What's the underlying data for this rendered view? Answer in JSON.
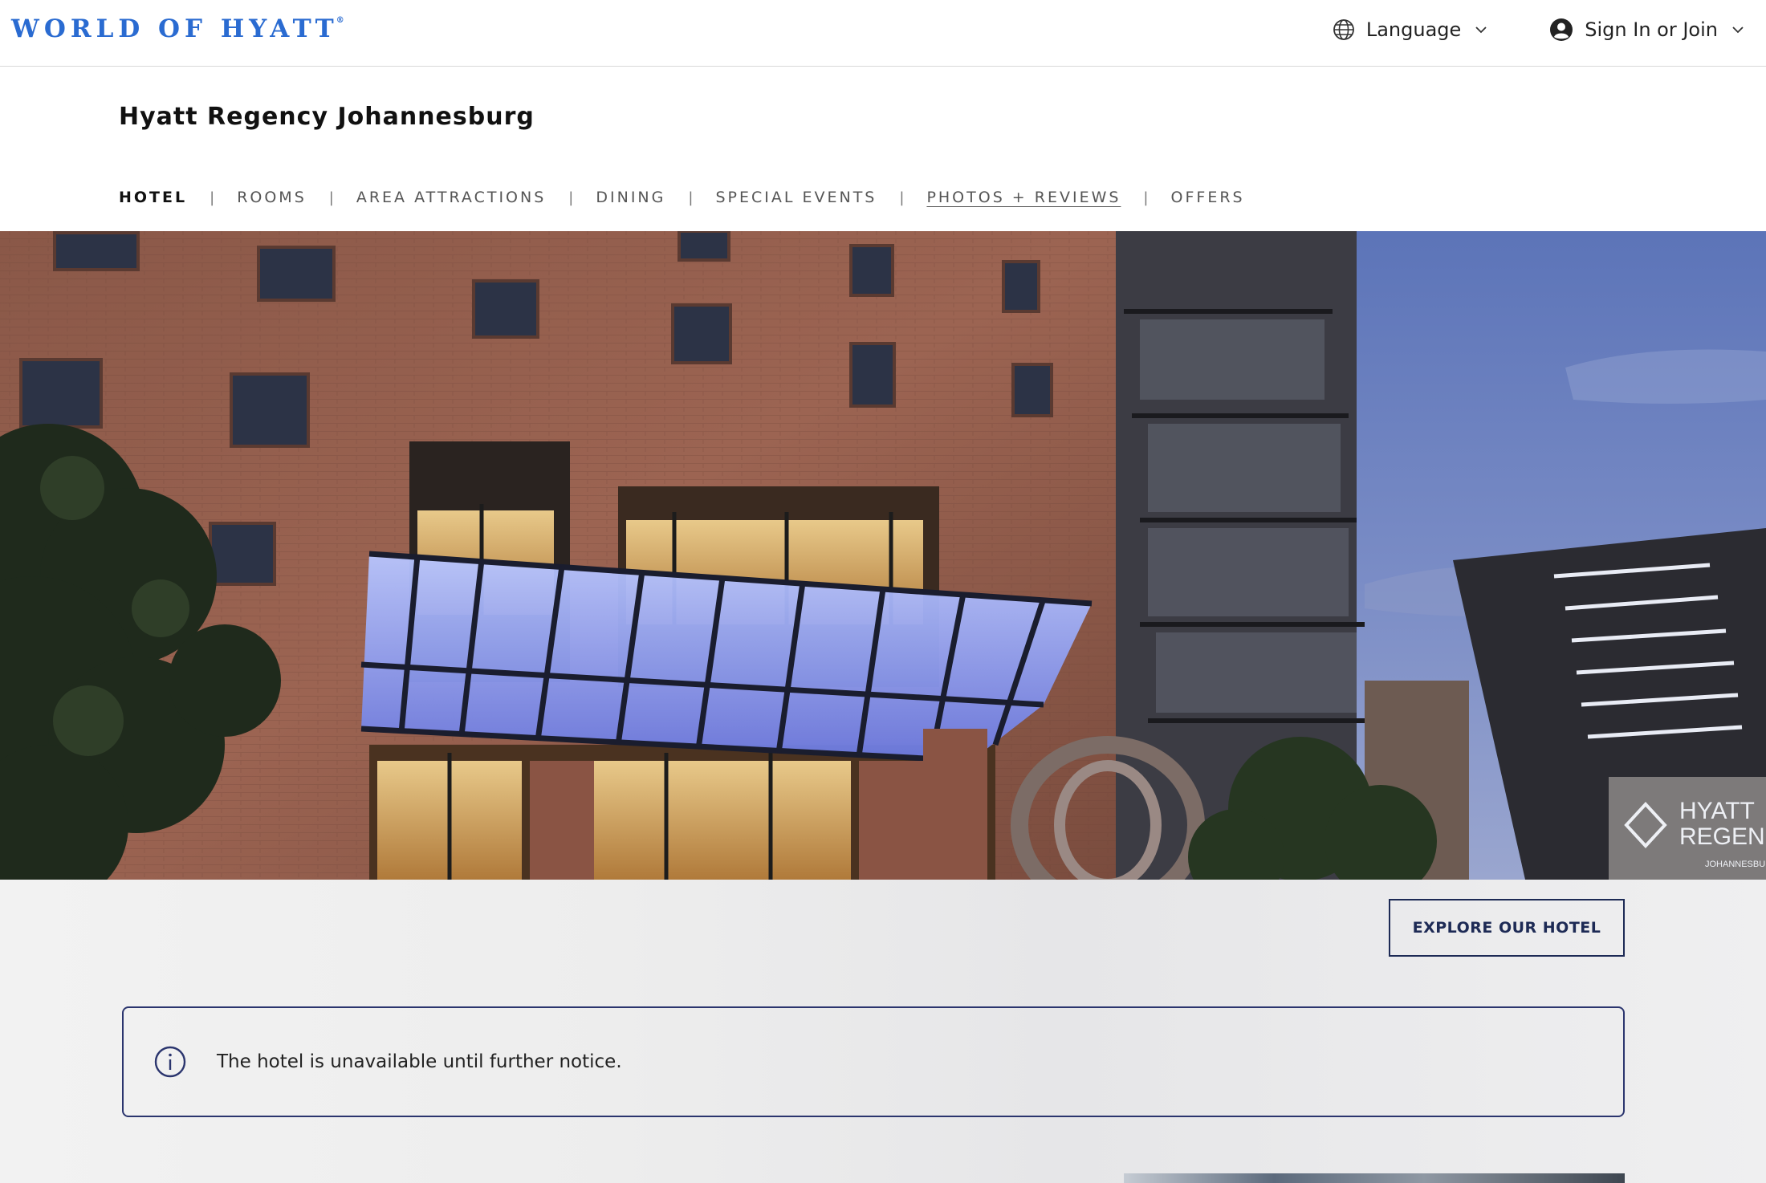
{
  "header": {
    "logo_text": "WORLD OF HYATT",
    "logo_mark": "®",
    "language_label": "Language",
    "signin_label": "Sign In or Join"
  },
  "hotel": {
    "name": "Hyatt Regency Johannesburg"
  },
  "nav": {
    "items": [
      {
        "label": "HOTEL",
        "active": true
      },
      {
        "label": "ROOMS"
      },
      {
        "label": "AREA ATTRACTIONS"
      },
      {
        "label": "DINING"
      },
      {
        "label": "SPECIAL EVENTS"
      },
      {
        "label": "PHOTOS + REVIEWS"
      },
      {
        "label": "OFFERS"
      }
    ],
    "separator": "|"
  },
  "hero": {
    "sign_text_1": "HYATT",
    "sign_text_2": "REGENCY",
    "sign_text_3": "JOHANNESBURG"
  },
  "actions": {
    "explore_label": "EXPLORE OUR HOTEL"
  },
  "notice": {
    "message": "The hotel is unavailable until further notice.",
    "icon": "info-icon"
  },
  "colors": {
    "logo_blue": "#2a6bd1",
    "navy": "#1d2a55",
    "notice_border": "#2b356e"
  }
}
